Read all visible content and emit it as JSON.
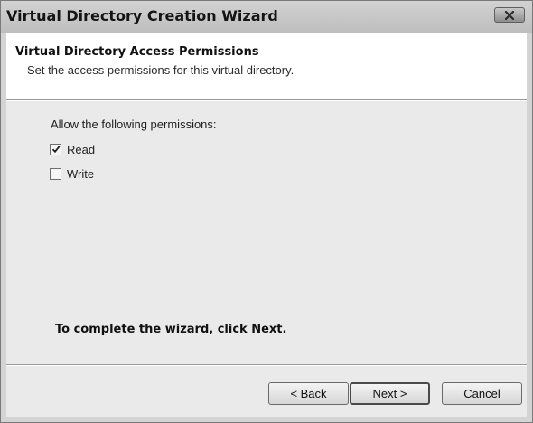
{
  "window": {
    "title": "Virtual Directory Creation Wizard",
    "close_icon": "close-icon"
  },
  "header": {
    "title": "Virtual Directory Access Permissions",
    "subtitle": "Set the access permissions for this virtual directory."
  },
  "permissions": {
    "label": "Allow the following permissions:",
    "items": [
      {
        "label": "Read",
        "checked": true
      },
      {
        "label": "Write",
        "checked": false
      }
    ]
  },
  "footer": {
    "instruction": "To complete the wizard, click Next."
  },
  "buttons": {
    "back": "< Back",
    "next": "Next >",
    "cancel": "Cancel"
  }
}
